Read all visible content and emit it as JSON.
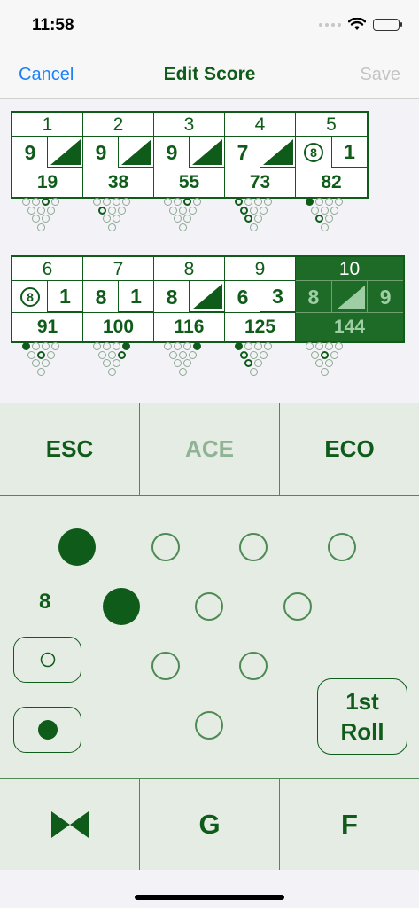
{
  "status_bar": {
    "time": "11:58"
  },
  "nav": {
    "cancel_label": "Cancel",
    "title": "Edit Score",
    "save_label": "Save"
  },
  "frames": [
    {
      "number": "1",
      "roll1": "9",
      "roll2": "/",
      "total": "19"
    },
    {
      "number": "2",
      "roll1": "9",
      "roll2": "/",
      "total": "38"
    },
    {
      "number": "3",
      "roll1": "9",
      "roll2": "/",
      "total": "55"
    },
    {
      "number": "4",
      "roll1": "7",
      "roll2": "/",
      "total": "73"
    },
    {
      "number": "5",
      "roll1": "8",
      "roll1_split": true,
      "roll2": "1",
      "total": "82"
    },
    {
      "number": "6",
      "roll1": "8",
      "roll1_split": true,
      "roll2": "1",
      "total": "91"
    },
    {
      "number": "7",
      "roll1": "8",
      "roll2": "1",
      "total": "100"
    },
    {
      "number": "8",
      "roll1": "8",
      "roll2": "/",
      "total": "116"
    },
    {
      "number": "9",
      "roll1": "6",
      "roll2": "3",
      "total": "125"
    },
    {
      "number": "10",
      "roll1": "8",
      "roll2": "/",
      "roll3": "9",
      "total": "144",
      "current": true
    }
  ],
  "controls": {
    "esc_label": "ESC",
    "ace_label": "ACE",
    "eco_label": "ECO",
    "pins_count": "8",
    "roll_label_line1": "1st",
    "roll_label_line2": "Roll",
    "split_icon": "bowtie-icon",
    "gutter_label": "G",
    "foul_label": "F"
  },
  "colors": {
    "accent": "#0f5c1a",
    "link": "#1a82fb",
    "disabled": "#c4c4c4",
    "panel": "#e5ece4"
  }
}
